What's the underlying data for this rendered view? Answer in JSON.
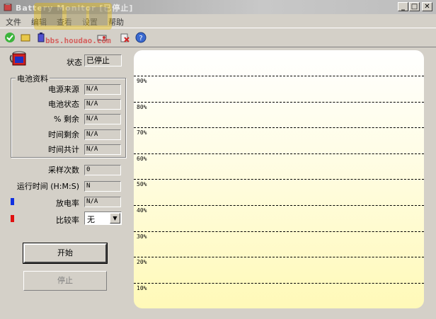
{
  "window": {
    "title": "Battery Monitor [已停止]"
  },
  "menu": [
    "文件",
    "编辑",
    "查看",
    "设置",
    "帮助"
  ],
  "toolbar": [
    "check-icon",
    "open-icon",
    "battery-icon",
    "settings-icon",
    "delete-icon",
    "help-icon"
  ],
  "watermark": {
    "text": "bbs.houdao.com"
  },
  "status": {
    "label": "状态",
    "value": "已停止"
  },
  "battery_info": {
    "group_title": "电池资料",
    "rows": [
      {
        "label": "电源来源",
        "value": "N/A"
      },
      {
        "label": "电池状态",
        "value": "N/A"
      },
      {
        "label": "% 剩余",
        "value": "N/A"
      },
      {
        "label": "时间剩余",
        "value": "N/A"
      },
      {
        "label": "时间共计",
        "value": "N/A"
      }
    ]
  },
  "samples": {
    "label": "采样次数",
    "value": "0"
  },
  "runtime": {
    "label": "运行时间 (H:M:S)",
    "value": "N"
  },
  "discharge": {
    "label": "放电率",
    "value": "N/A",
    "color": "#1030e0"
  },
  "compare": {
    "label": "比较率",
    "value": "无",
    "color": "#e01010"
  },
  "buttons": {
    "start": "开始",
    "stop": "停止"
  },
  "chart_data": {
    "type": "line",
    "y_ticks": [
      "90%",
      "80%",
      "70%",
      "60%",
      "50%",
      "40%",
      "30%",
      "20%",
      "10%"
    ],
    "grid": "dashed",
    "series": []
  }
}
